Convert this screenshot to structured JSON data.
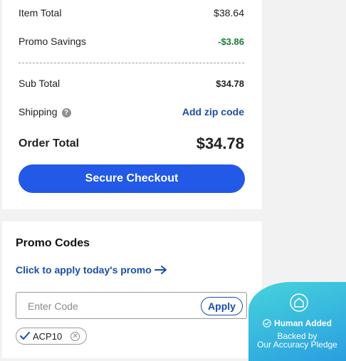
{
  "summary": {
    "item_total_label": "Item Total",
    "item_total_value": "$38.64",
    "promo_savings_label": "Promo Savings",
    "promo_savings_value": "-$3.86",
    "sub_total_label": "Sub Total",
    "sub_total_value": "$34.78",
    "shipping_label": "Shipping",
    "shipping_help_icon": "?",
    "add_zip_label": "Add zip code",
    "order_total_label": "Order Total",
    "order_total_value": "$34.78",
    "checkout_label": "Secure Checkout"
  },
  "promo": {
    "title": "Promo Codes",
    "apply_today_label": "Click to apply today's promo",
    "input_placeholder": "Enter Code",
    "input_value": "",
    "apply_label": "Apply",
    "applied_code": "ACP10"
  },
  "badge": {
    "title": "Human Added",
    "sub_line1": "Backed by",
    "sub_line2": "Our Accuracy Pledge"
  },
  "colors": {
    "primary_button": "#2259e6",
    "link": "#1c4ea6",
    "savings_green": "#1a7a3a",
    "badge_gradient_start": "#46d3dc",
    "badge_gradient_end": "#2a9ee0"
  },
  "icons": {
    "help": "question-circle-icon",
    "arrow": "arrow-right-icon",
    "check": "checkmark-icon",
    "remove": "close-circle-icon",
    "home": "home-pentagon-icon",
    "verified": "check-circle-icon"
  }
}
